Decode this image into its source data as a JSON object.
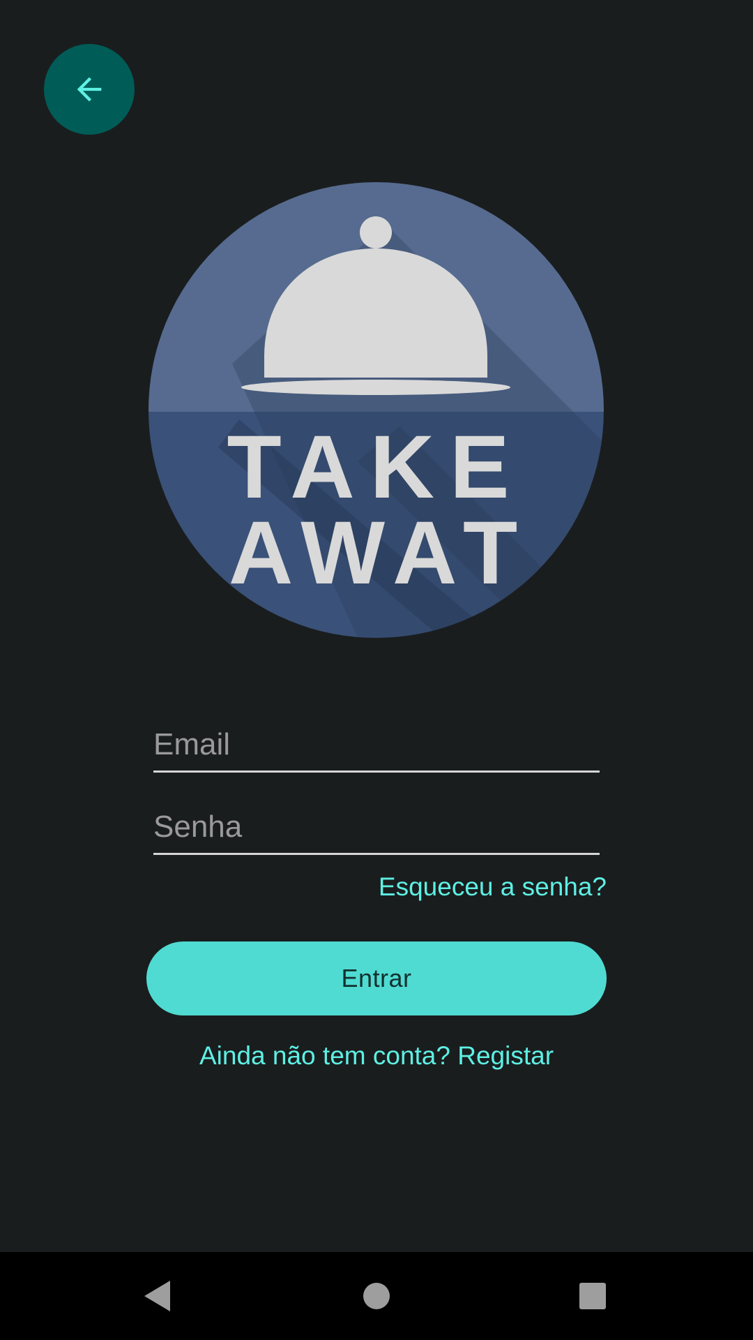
{
  "logo": {
    "line1": "TAKE",
    "line2": "AWAT"
  },
  "form": {
    "email_placeholder": "Email",
    "password_placeholder": "Senha",
    "forgot_password": "Esqueceu a senha?",
    "login_label": "Entrar",
    "register_prompt": "Ainda não tem conta? Registar"
  },
  "icons": {
    "back": "arrow-left-icon",
    "nav_back": "triangle-back-icon",
    "nav_home": "circle-home-icon",
    "nav_recents": "square-recents-icon"
  },
  "colors": {
    "background": "#1a1d1e",
    "accent": "#4fdbd2",
    "link": "#5ef0e4",
    "back_button": "#005c57",
    "logo_top": "#566b8f",
    "logo_bottom": "#3a5179"
  }
}
